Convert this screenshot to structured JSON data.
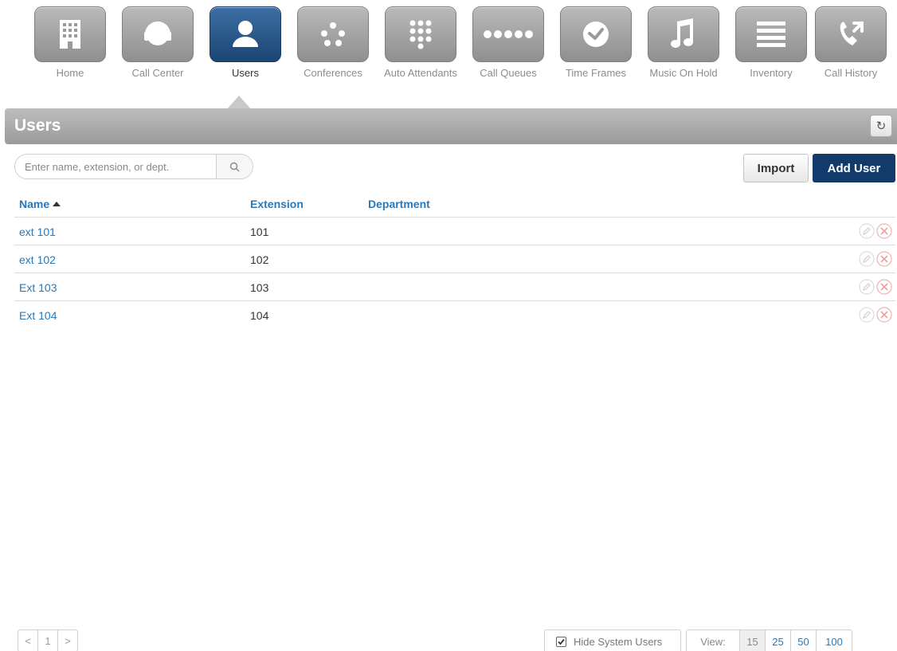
{
  "nav": {
    "items": [
      {
        "label": "Home",
        "icon": "building-icon"
      },
      {
        "label": "Call Center",
        "icon": "headset-icon"
      },
      {
        "label": "Users",
        "icon": "user-icon",
        "active": true
      },
      {
        "label": "Conferences",
        "icon": "conference-dots-icon"
      },
      {
        "label": "Auto Attendants",
        "icon": "keypad-icon"
      },
      {
        "label": "Call Queues",
        "icon": "queue-dots-icon"
      },
      {
        "label": "Time Frames",
        "icon": "clock-icon"
      },
      {
        "label": "Music On Hold",
        "icon": "music-note-icon"
      },
      {
        "label": "Inventory",
        "icon": "list-lines-icon"
      },
      {
        "label": "Call History",
        "icon": "phone-arrows-icon"
      }
    ],
    "active_color": "#1b4573"
  },
  "header": {
    "title": "Users"
  },
  "search": {
    "placeholder": "Enter name, extension, or dept."
  },
  "actions": {
    "import_label": "Import",
    "add_label": "Add User"
  },
  "table": {
    "columns": [
      "Name",
      "Extension",
      "Department"
    ],
    "sorted_by": "Name",
    "rows": [
      {
        "name": "ext 101",
        "extension": "101",
        "department": ""
      },
      {
        "name": "ext 102",
        "extension": "102",
        "department": ""
      },
      {
        "name": "Ext 103",
        "extension": "103",
        "department": ""
      },
      {
        "name": "Ext 104",
        "extension": "104",
        "department": ""
      }
    ]
  },
  "pager": {
    "prev": "<",
    "page": "1",
    "next": ">"
  },
  "footer": {
    "hide_system_users_label": "Hide System Users",
    "hide_system_users_checked": true,
    "view_label": "View:",
    "view_options": [
      "15",
      "25",
      "50",
      "100"
    ],
    "view_selected": "15"
  },
  "colors": {
    "link": "#2a78b8",
    "primary_button": "#123a6a",
    "delete": "#e8a0a0"
  }
}
